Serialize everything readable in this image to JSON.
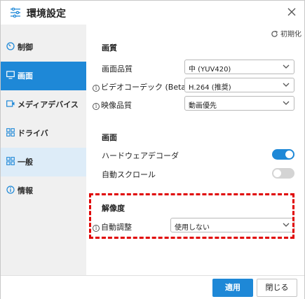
{
  "window": {
    "title": "環境設定",
    "title_icon": "sliders-icon",
    "close_icon": "close-icon"
  },
  "sidebar": {
    "items": [
      {
        "label": "制御",
        "icon": "gauge-icon"
      },
      {
        "label": "画面",
        "icon": "monitor-icon",
        "state": "selected"
      },
      {
        "label": "メディアデバイス",
        "icon": "media-device-icon"
      },
      {
        "label": "ドライバ",
        "icon": "driver-icon"
      },
      {
        "label": "一般",
        "icon": "grid-icon",
        "state": "hover"
      },
      {
        "label": "情報",
        "icon": "info-icon"
      }
    ]
  },
  "main": {
    "reset_label": "初期化",
    "image_quality": {
      "title": "画質",
      "rows": [
        {
          "label": "画面品質",
          "value": "中 (YUV420)",
          "info": false
        },
        {
          "label": "ビデオコーデック (Beta)",
          "value": "H.264 (推奨)",
          "info": true
        },
        {
          "label": "映像品質",
          "value": "動画優先",
          "info": true
        }
      ]
    },
    "screen": {
      "title": "画面",
      "rows": [
        {
          "label": "ハードウェアデコーダ",
          "on": true
        },
        {
          "label": "自動スクロール",
          "on": false
        }
      ]
    },
    "resolution": {
      "title": "解像度",
      "label": "自動調整",
      "value": "使用しない"
    }
  },
  "footer": {
    "apply_label": "適用",
    "close_label": "閉じる"
  },
  "colors": {
    "accent": "#1e88d7",
    "sidebar_bg": "#f0f0f0",
    "highlight_box": "#e00000"
  }
}
